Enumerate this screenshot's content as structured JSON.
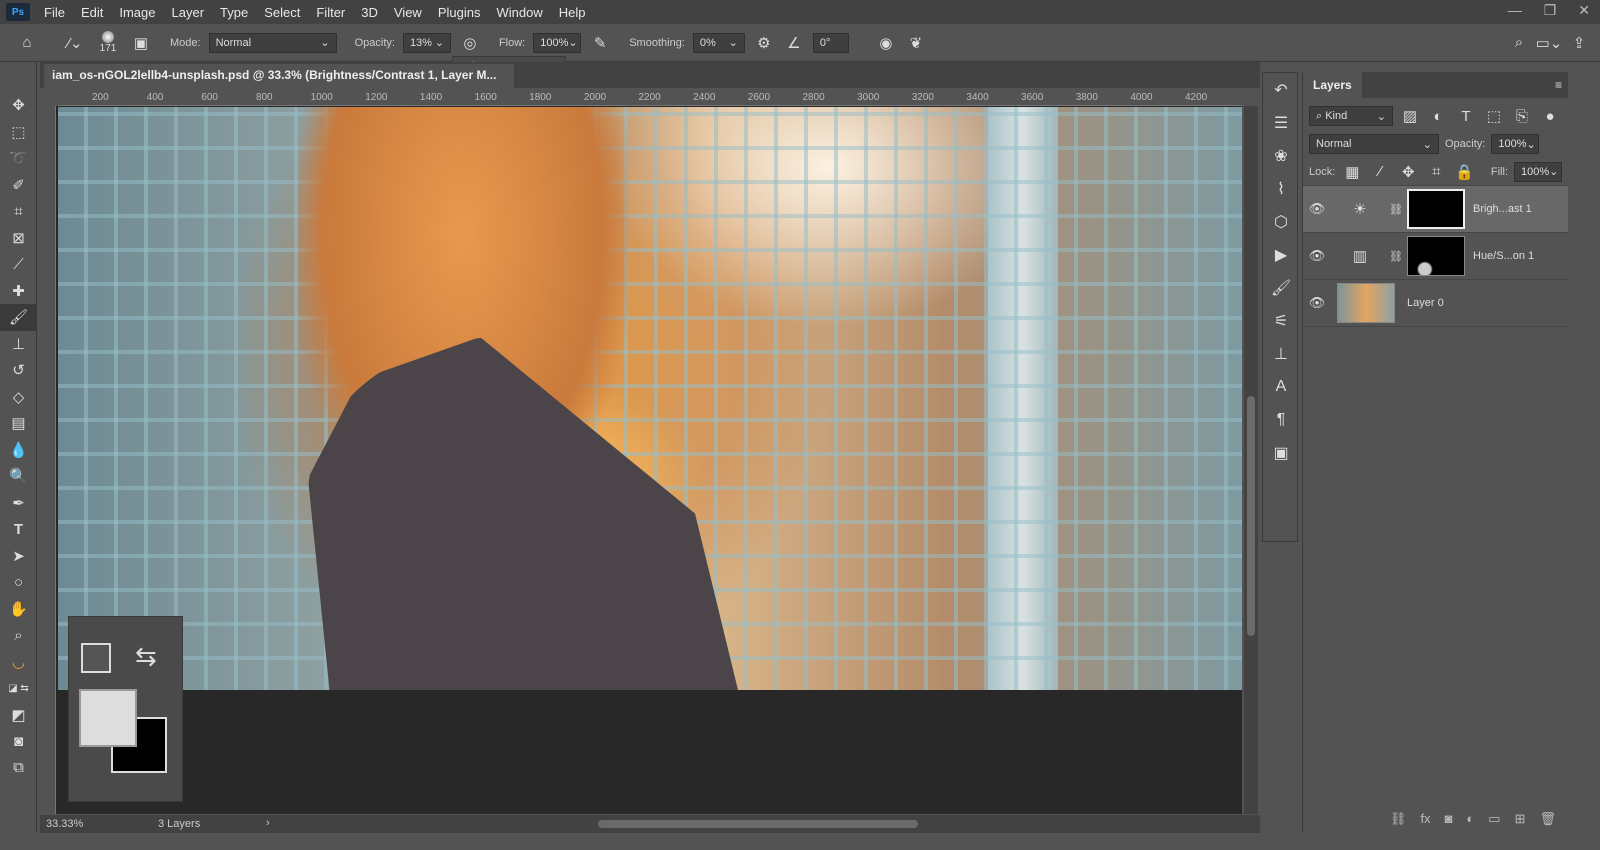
{
  "app": {
    "logo": "Ps",
    "menu": [
      "File",
      "Edit",
      "Image",
      "Layer",
      "Type",
      "Select",
      "Filter",
      "3D",
      "View",
      "Plugins",
      "Window",
      "Help"
    ]
  },
  "options": {
    "brush_size": "171",
    "mode_label": "Mode:",
    "mode": "Normal",
    "opacity_label": "Opacity:",
    "opacity": "13%",
    "opacity_slider_percent": 13,
    "flow_label": "Flow:",
    "flow": "100%",
    "smoothing_label": "Smoothing:",
    "smoothing": "0%",
    "angle": "0°"
  },
  "document": {
    "tab_title": "iam_os-nGOL2lellb4-unsplash.psd @ 33.3% (Brightness/Contrast 1, Layer M..."
  },
  "ruler": {
    "top": [
      "200",
      "400",
      "600",
      "800",
      "1000",
      "1200",
      "1400",
      "1600",
      "1800",
      "2000",
      "2200",
      "2400",
      "2600",
      "2800",
      "3000",
      "3200",
      "3400",
      "3600",
      "3800",
      "4000",
      "4200"
    ]
  },
  "status": {
    "zoom": "33.33%",
    "info": "3 Layers"
  },
  "layers_panel": {
    "title": "Layers",
    "filter": "Kind",
    "blend_mode": "Normal",
    "opacity_label": "Opacity:",
    "opacity": "100%",
    "lock_label": "Lock:",
    "fill_label": "Fill:",
    "fill": "100%",
    "layers": [
      {
        "name": "Brigh...ast 1",
        "icon": "brightness-icon",
        "selected": true
      },
      {
        "name": "Hue/S...on 1",
        "icon": "hue-saturation-icon",
        "selected": false
      },
      {
        "name": "Layer 0",
        "icon": "",
        "selected": false
      }
    ]
  }
}
